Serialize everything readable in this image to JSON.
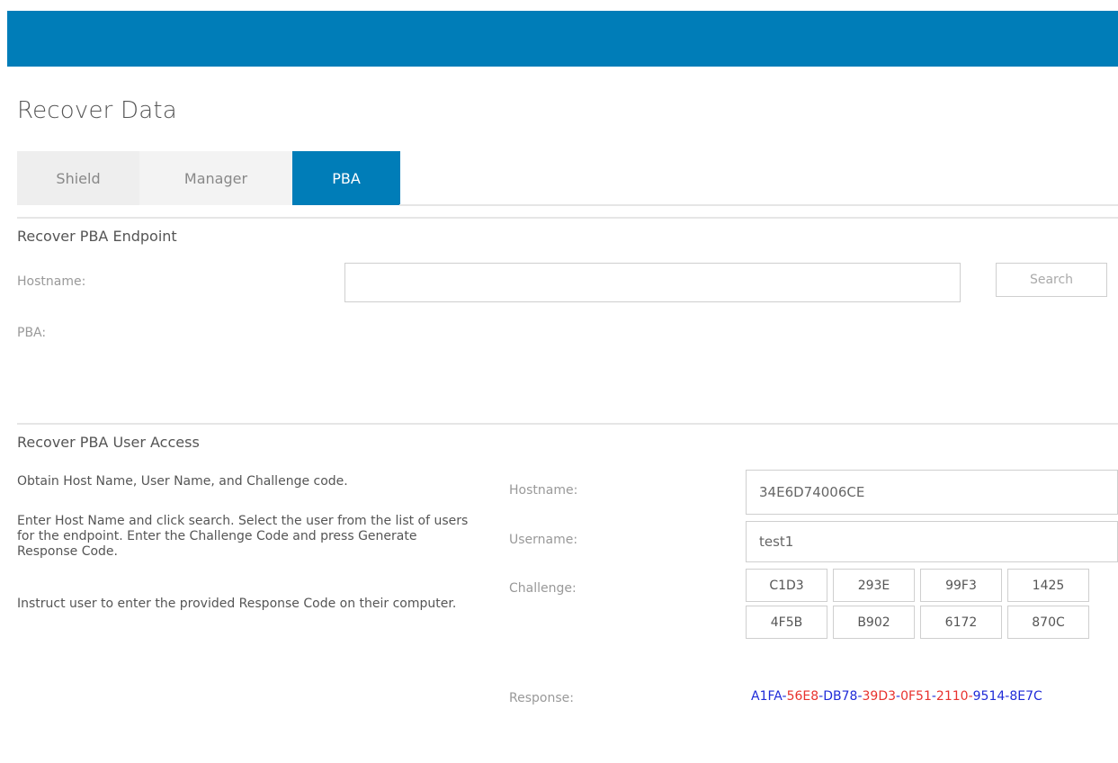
{
  "page": {
    "title": "Recover Data"
  },
  "tabs": [
    {
      "label": "Shield"
    },
    {
      "label": "Manager"
    },
    {
      "label": "PBA"
    }
  ],
  "endpoint": {
    "section_title": "Recover PBA Endpoint",
    "hostname_label": "Hostname:",
    "hostname_value": "",
    "search_label": "Search",
    "pba_label": "PBA:"
  },
  "user_access": {
    "section_title": "Recover PBA User Access",
    "instructions": [
      "Obtain Host Name, User Name, and Challenge code.",
      "Enter Host Name and click search. Select the user from the list of users for the endpoint. Enter the Challenge Code and press Generate Response Code.",
      "Instruct user to enter the provided Response Code on their computer."
    ],
    "hostname_label": "Hostname:",
    "hostname_value": "34E6D74006CE",
    "username_label": "Username:",
    "username_value": "test1",
    "challenge_label": "Challenge:",
    "challenge": [
      "C1D3",
      "293E",
      "99F3",
      "1425",
      "4F5B",
      "B902",
      "6172",
      "870C"
    ],
    "response_label": "Response:",
    "response_parts": [
      {
        "text": "A1FA",
        "color": "#1f2bd8"
      },
      {
        "text": "-",
        "color": "#1f2bd8"
      },
      {
        "text": "56E8",
        "color": "#e8322e"
      },
      {
        "text": "-",
        "color": "#1f2bd8"
      },
      {
        "text": "DB78",
        "color": "#1f2bd8"
      },
      {
        "text": "-",
        "color": "#1f2bd8"
      },
      {
        "text": "39D3",
        "color": "#e8322e"
      },
      {
        "text": "-",
        "color": "#1f2bd8"
      },
      {
        "text": "0F51",
        "color": "#e8322e"
      },
      {
        "text": "-",
        "color": "#1f2bd8"
      },
      {
        "text": "2110",
        "color": "#e8322e"
      },
      {
        "text": "-",
        "color": "#e8322e"
      },
      {
        "text": "9514",
        "color": "#1f2bd8"
      },
      {
        "text": "-",
        "color": "#1f2bd8"
      },
      {
        "text": "8E7C",
        "color": "#1f2bd8"
      }
    ]
  },
  "colors": {
    "accent": "#007db8",
    "response_blue": "#1f2bd8",
    "response_red": "#e8322e"
  }
}
